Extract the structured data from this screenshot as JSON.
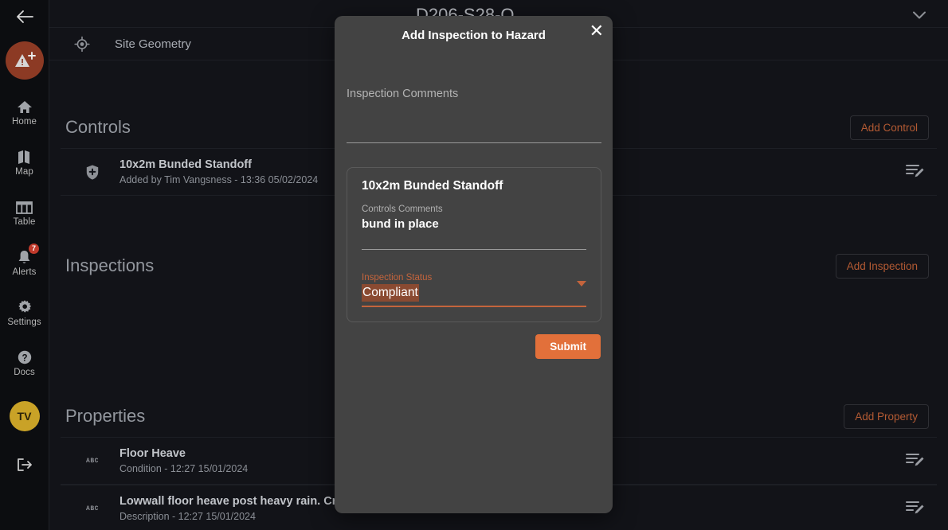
{
  "colors": {
    "page_bg": "#121318",
    "sidebar_bg": "#0c0d10",
    "modal_bg": "#434343",
    "accent_orange": "#e2703a",
    "outline_btn_text": "#b35a33",
    "badge_red": "#c0392b",
    "avatar_yellow": "#c9a227",
    "logo_bg": "#8c3a24"
  },
  "sidebar": {
    "back_icon": "arrow-left-icon",
    "logo_icon": "hazard-add-icon",
    "items": [
      {
        "label": "Home",
        "icon": "home-icon"
      },
      {
        "label": "Map",
        "icon": "map-icon"
      },
      {
        "label": "Table",
        "icon": "table-icon"
      },
      {
        "label": "Alerts",
        "icon": "bell-icon",
        "badge": "7"
      },
      {
        "label": "Settings",
        "icon": "gear-icon"
      },
      {
        "label": "Docs",
        "icon": "question-circle-icon"
      }
    ],
    "avatar_initials": "TV",
    "logout_icon": "logout-icon"
  },
  "main": {
    "page_title": "D206-S28-O",
    "geometry_row": {
      "label": "Site Geometry",
      "icon": "target-icon"
    },
    "collapse_icon": "chevron-down-icon",
    "sections": [
      {
        "title": "Controls",
        "action_label": "Add Control",
        "rows": [
          {
            "icon": "shield-plus-icon",
            "title": "10x2m Bunded Standoff",
            "subtitle": "Added by Tim Vangsness - 13:36   05/02/2024",
            "action_icon": "note-edit-icon"
          }
        ]
      },
      {
        "title": "Inspections",
        "action_label": "Add Inspection",
        "rows": []
      },
      {
        "title": "Properties",
        "action_label": "Add Property",
        "rows": [
          {
            "icon": "abc-icon",
            "icon_text": "ABC",
            "title": "Floor Heave",
            "subtitle": "Condition - 12:27   15/01/2024",
            "action_icon": "note-edit-icon"
          },
          {
            "icon": "abc-icon",
            "icon_text": "ABC",
            "title": "Lowwall floor heave post heavy rain. Cracking behind first DRZ spoil peak.",
            "subtitle": "Description - 12:27   15/01/2024",
            "action_icon": "note-edit-icon"
          }
        ]
      }
    ]
  },
  "modal": {
    "title": "Add Inspection to Hazard",
    "close_icon": "close-icon",
    "inspection_comments": {
      "label": "Inspection Comments",
      "value": ""
    },
    "card": {
      "title": "10x2m Bunded Standoff",
      "controls_comments_label": "Controls Comments",
      "controls_comments_value": "bund in place",
      "inspection_status_label": "Inspection Status",
      "inspection_status_value": "Compliant",
      "dropdown_icon": "caret-down-icon"
    },
    "submit_label": "Submit"
  }
}
